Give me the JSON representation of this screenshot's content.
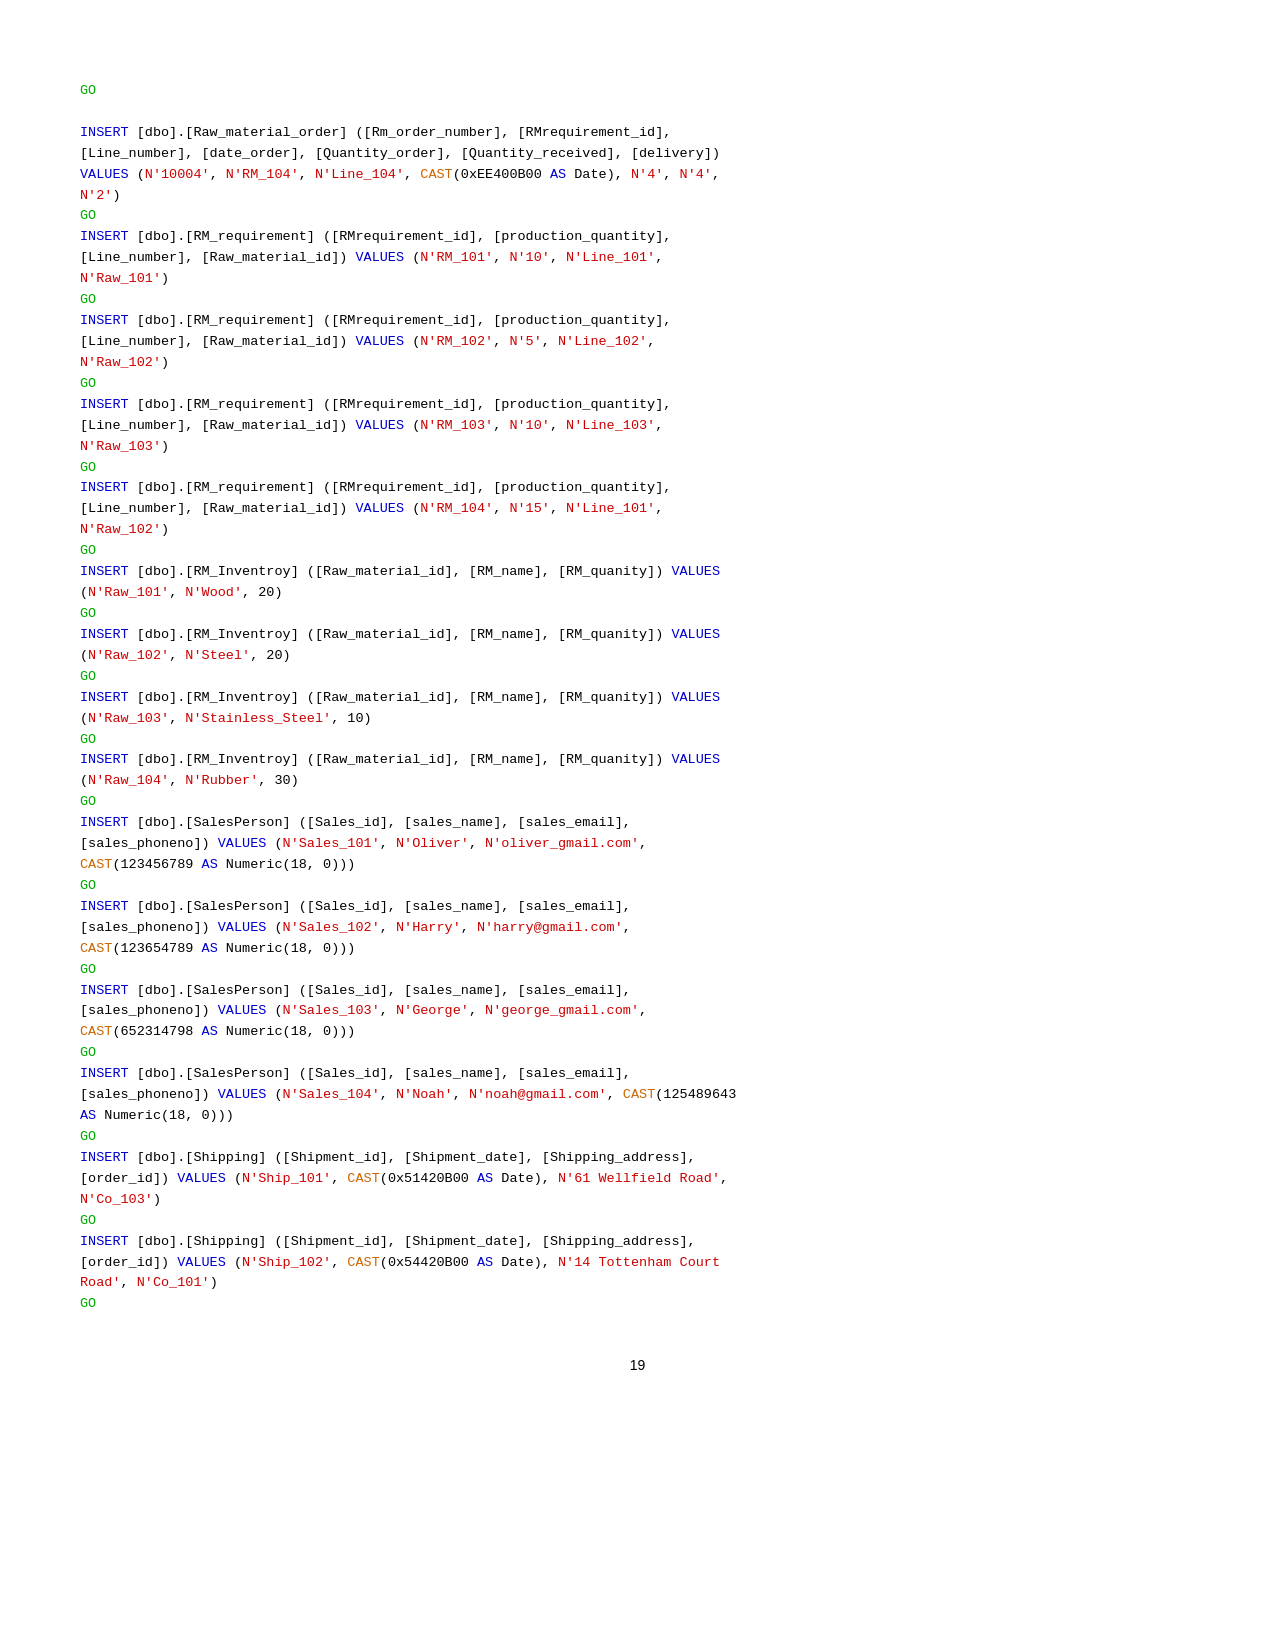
{
  "page": {
    "number": "19",
    "code_lines": []
  }
}
